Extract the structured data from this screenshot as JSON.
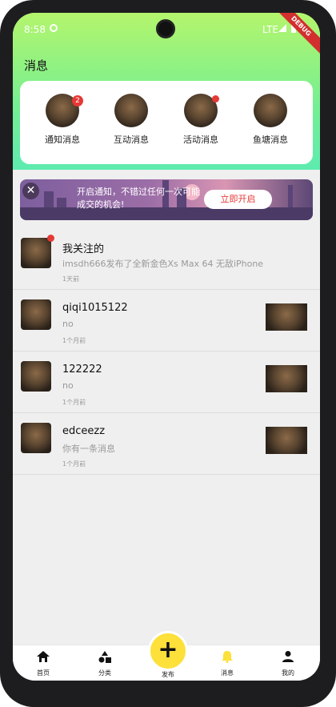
{
  "status_bar": {
    "time": "8:58",
    "network": "LTE",
    "debug_label": "DEBUG"
  },
  "header": {
    "title": "消息"
  },
  "categories": [
    {
      "label": "通知消息",
      "badge": "2"
    },
    {
      "label": "互动消息"
    },
    {
      "label": "活动消息",
      "dot": true
    },
    {
      "label": "鱼塘消息"
    }
  ],
  "banner": {
    "text": "开启通知，不错过任何一次可能成交的机会!",
    "button": "立即开启"
  },
  "messages": [
    {
      "name": "我关注的",
      "subtitle": "imsdh666发布了全新金色Xs Max 64 无敌iPhone",
      "time": "1天前"
    },
    {
      "name": "qiqi1015122",
      "subtitle": "no",
      "time": "1个月前"
    },
    {
      "name": "122222",
      "subtitle": "no",
      "time": "1个月前"
    },
    {
      "name": "edceezz",
      "subtitle": "你有一条消息",
      "time": "1个月前"
    }
  ],
  "nav": [
    {
      "label": "首页",
      "icon": "home-icon"
    },
    {
      "label": "分类",
      "icon": "category-icon"
    },
    {
      "label": "发布",
      "icon": "plus-icon"
    },
    {
      "label": "消息",
      "icon": "bell-icon"
    },
    {
      "label": "我的",
      "icon": "person-icon"
    }
  ],
  "colors": {
    "accent_yellow": "#fde03a",
    "header_green": "#75ef93",
    "badge_red": "#e53935"
  }
}
